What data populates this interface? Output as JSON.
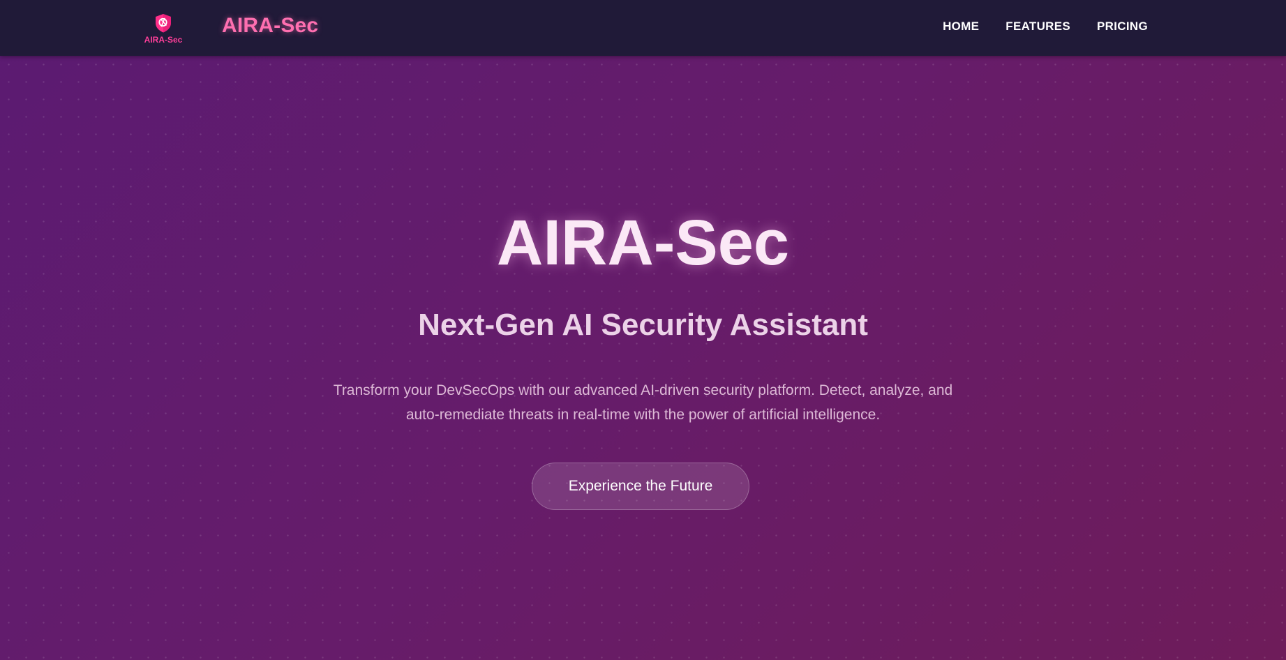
{
  "navbar": {
    "logo_badge_text": "AIRA-Sec",
    "brand": "AIRA-Sec",
    "links": [
      {
        "label": "HOME"
      },
      {
        "label": "FEATURES"
      },
      {
        "label": "PRICING"
      }
    ]
  },
  "hero": {
    "title": "AIRA-Sec",
    "subtitle": "Next-Gen AI Security Assistant",
    "description": "Transform your DevSecOps with our advanced AI-driven security platform. Detect, analyze, and auto-remediate threats in real-time with the power of artificial intelligence.",
    "cta_label": "Experience the Future"
  },
  "icons": {
    "logo": "shield-icon"
  },
  "colors": {
    "navbar_bg": "#201a38",
    "accent_pink": "#ff6fb0",
    "logo_pink": "#ff2f8a",
    "hero_gradient_start": "#5b1b72",
    "hero_gradient_end": "#6e1c5a"
  }
}
